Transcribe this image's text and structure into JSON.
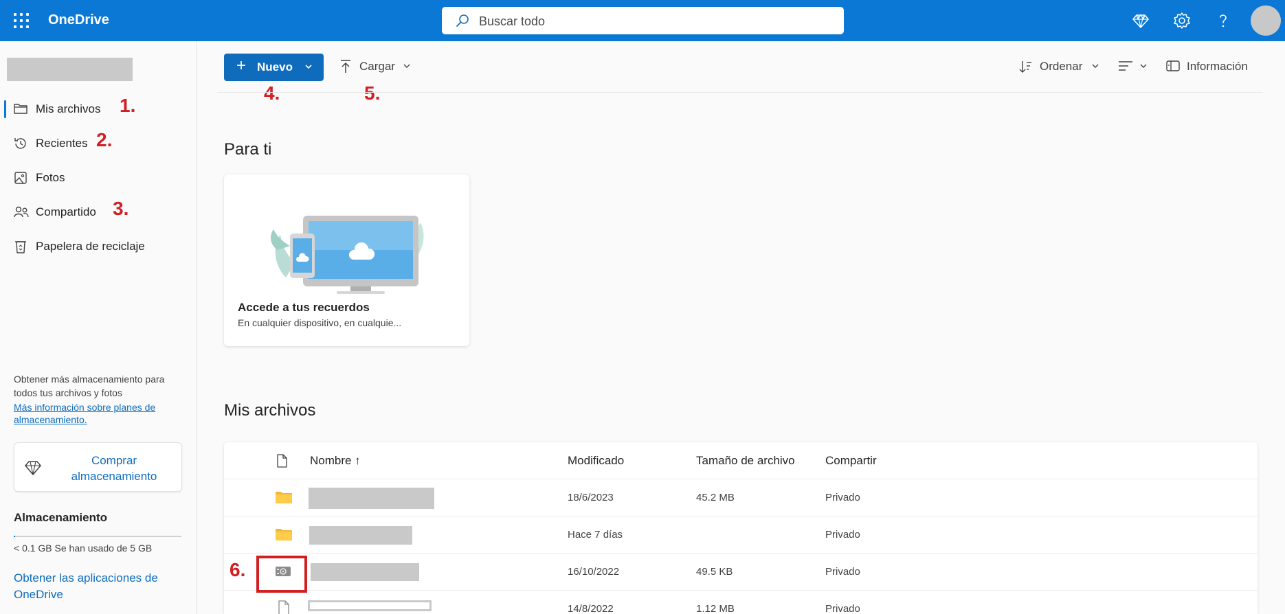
{
  "app": {
    "name": "OneDrive",
    "brand_color": "#0a78d4"
  },
  "search": {
    "placeholder": "Buscar todo"
  },
  "header_icons": [
    "premium-diamond-icon",
    "settings-gear-icon",
    "help-icon",
    "avatar"
  ],
  "sidebar": {
    "items": [
      {
        "label": "Mis archivos",
        "icon": "folder-icon",
        "active": true,
        "annotation": "1."
      },
      {
        "label": "Recientes",
        "icon": "history-clock-icon",
        "active": false,
        "annotation": "2."
      },
      {
        "label": "Fotos",
        "icon": "photo-icon",
        "active": false,
        "annotation": ""
      },
      {
        "label": "Compartido",
        "icon": "people-icon",
        "active": false,
        "annotation": "3."
      },
      {
        "label": "Papelera de reciclaje",
        "icon": "recycle-bin-icon",
        "active": false,
        "annotation": ""
      }
    ],
    "promo_text": "Obtener más almacenamiento para todos tus archivos y fotos",
    "promo_link": "Más información sobre planes de almacenamiento.",
    "buy_button": "Comprar almacenamiento",
    "storage_title": "Almacenamiento",
    "storage_text": "< 0.1 GB Se han usado de 5 GB",
    "storage_used_fraction": 0.01,
    "apps_link": "Obtener las aplicaciones de OneDrive"
  },
  "commandbar": {
    "new_label": "Nuevo",
    "new_annotation": "4.",
    "upload_label": "Cargar",
    "upload_annotation": "5.",
    "sort_label": "Ordenar",
    "info_label": "Información"
  },
  "for_you": {
    "title": "Para ti",
    "card_title": "Accede a tus recuerdos",
    "card_subtitle": "En cualquier dispositivo, en cualquie..."
  },
  "files": {
    "title": "Mis archivos",
    "columns": {
      "name": "Nombre ↑",
      "modified": "Modificado",
      "size": "Tamaño de archivo",
      "sharing": "Compartir"
    },
    "rows": [
      {
        "type": "folder",
        "modified": "18/6/2023",
        "size": "45.2 MB",
        "sharing": "Privado"
      },
      {
        "type": "folder",
        "modified": "Hace 7 días",
        "size": "",
        "sharing": "Privado"
      },
      {
        "type": "vault",
        "modified": "16/10/2022",
        "size": "49.5 KB",
        "sharing": "Privado",
        "annotation": "6."
      },
      {
        "type": "file",
        "modified": "14/8/2022",
        "size": "1.12 MB",
        "sharing": "Privado"
      }
    ]
  },
  "annotation_color": "#d21f22"
}
